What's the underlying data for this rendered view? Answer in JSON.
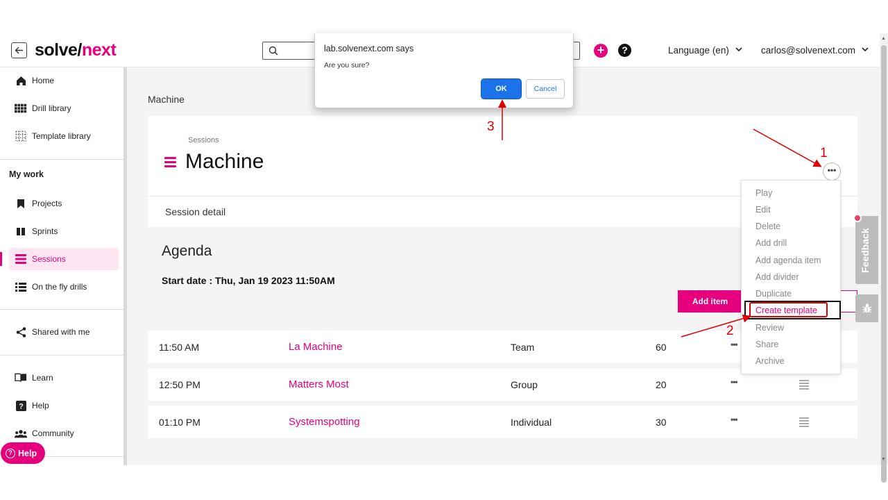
{
  "header": {
    "logo_part1": "solve/",
    "logo_part2": "next",
    "language": "Language (en)",
    "account": "carlos@solvenext.com",
    "search_placeholder": ""
  },
  "sidebar": {
    "items": [
      {
        "label": "Home",
        "icon": "home-icon"
      },
      {
        "label": "Drill library",
        "icon": "grid-icon"
      },
      {
        "label": "Template library",
        "icon": "dotted-grid-icon"
      },
      {
        "label": "Projects",
        "icon": "bookmark-icon"
      },
      {
        "label": "Sprints",
        "icon": "columns-icon"
      },
      {
        "label": "Sessions",
        "icon": "menu-lines-icon"
      },
      {
        "label": "On the fly drills",
        "icon": "list-icon"
      },
      {
        "label": "Shared with me",
        "icon": "share-icon"
      },
      {
        "label": "Learn",
        "icon": "book-icon"
      },
      {
        "label": "Help",
        "icon": "question-icon"
      },
      {
        "label": "Community",
        "icon": "people-icon"
      }
    ],
    "my_work_heading": "My work",
    "help_button": "Help"
  },
  "main": {
    "breadcrumb": "Machine",
    "sessions_label": "Sessions",
    "title": "Machine",
    "session_detail": "Session detail",
    "agenda": "Agenda",
    "start_date": "Start date : Thu, Jan 19 2023 11:50AM",
    "add_item": "Add item",
    "rows": [
      {
        "time": "11:50 AM",
        "name": "La Machine",
        "type": "Team",
        "minutes": "60"
      },
      {
        "time": "12:50 PM",
        "name": "Matters Most",
        "type": "Group",
        "minutes": "20"
      },
      {
        "time": "01:10 PM",
        "name": "Systemspotting",
        "type": "Individual",
        "minutes": "30"
      }
    ]
  },
  "menu": {
    "items": [
      "Play",
      "Edit",
      "Delete",
      "Add drill",
      "Add agenda item",
      "Add divider",
      "Duplicate",
      "Create template",
      "Review",
      "Share",
      "Archive"
    ],
    "highlighted": "Create template"
  },
  "feedback_tab": "Feedback",
  "dialog": {
    "title": "lab.solvenext.com says",
    "message": "Are you sure?",
    "ok": "OK",
    "cancel": "Cancel"
  },
  "annotations": {
    "step1": "1",
    "step2": "2",
    "step3": "3"
  },
  "colors": {
    "brand": "#e6007e",
    "ok_button": "#1a73e8",
    "annotation": "#e00000"
  }
}
